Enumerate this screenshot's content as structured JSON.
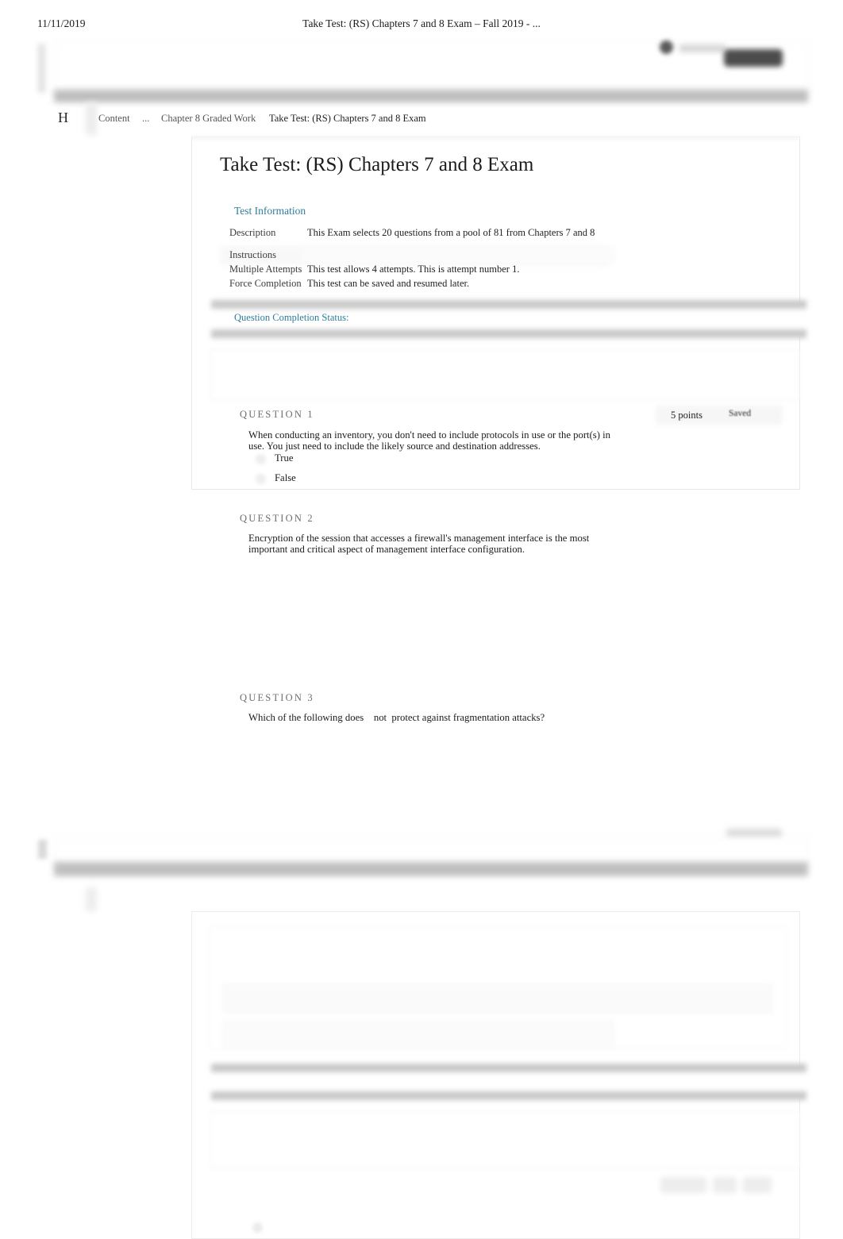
{
  "print_header": {
    "date": "11/11/2019",
    "document_title": "Take Test: (RS) Chapters 7 and 8 Exam – Fall 2019 - ..."
  },
  "colors": {
    "link_teal": "#2e7d9a",
    "body_text": "#1c1c1c",
    "muted_text": "#6e6e6e"
  },
  "breadcrumb": {
    "home_glyph": "H",
    "items": [
      {
        "label": "Content"
      },
      {
        "label": "..."
      },
      {
        "label": "Chapter 8 Graded Work"
      },
      {
        "label": "Take Test: (RS) Chapters 7 and 8 Exam"
      }
    ]
  },
  "page": {
    "title": "Take Test: (RS) Chapters 7 and 8 Exam"
  },
  "test_information": {
    "heading": "Test Information",
    "rows": [
      {
        "label": "Description",
        "value": "This Exam selects 20 questions from a pool of 81 from Chapters 7 and 8"
      },
      {
        "label": "Instructions",
        "value": ""
      },
      {
        "label": "Multiple Attempts",
        "value": "This test allows 4 attempts. This is attempt number 1."
      },
      {
        "label": "Force Completion",
        "value": "This test can be saved and resumed later."
      }
    ]
  },
  "question_completion_status": {
    "label": "Question Completion Status:"
  },
  "questions": [
    {
      "number_label": "QUESTION 1",
      "text": "When conducting an inventory, you don't need to include protocols in use or the port(s) in use. You just need to include the likely source and destination addresses.",
      "points": "5 points",
      "status": "Saved",
      "options": [
        {
          "label": "True"
        },
        {
          "label": "False"
        }
      ]
    },
    {
      "number_label": "QUESTION 2",
      "text": "Encryption of the session that accesses a firewall's management interface is the most important and critical aspect of management interface configuration.",
      "points": "",
      "status": "",
      "options": []
    },
    {
      "number_label": "QUESTION 3",
      "text": "Which of the following does    not  protect against fragmentation attacks?",
      "points": "",
      "status": "",
      "options": []
    }
  ]
}
